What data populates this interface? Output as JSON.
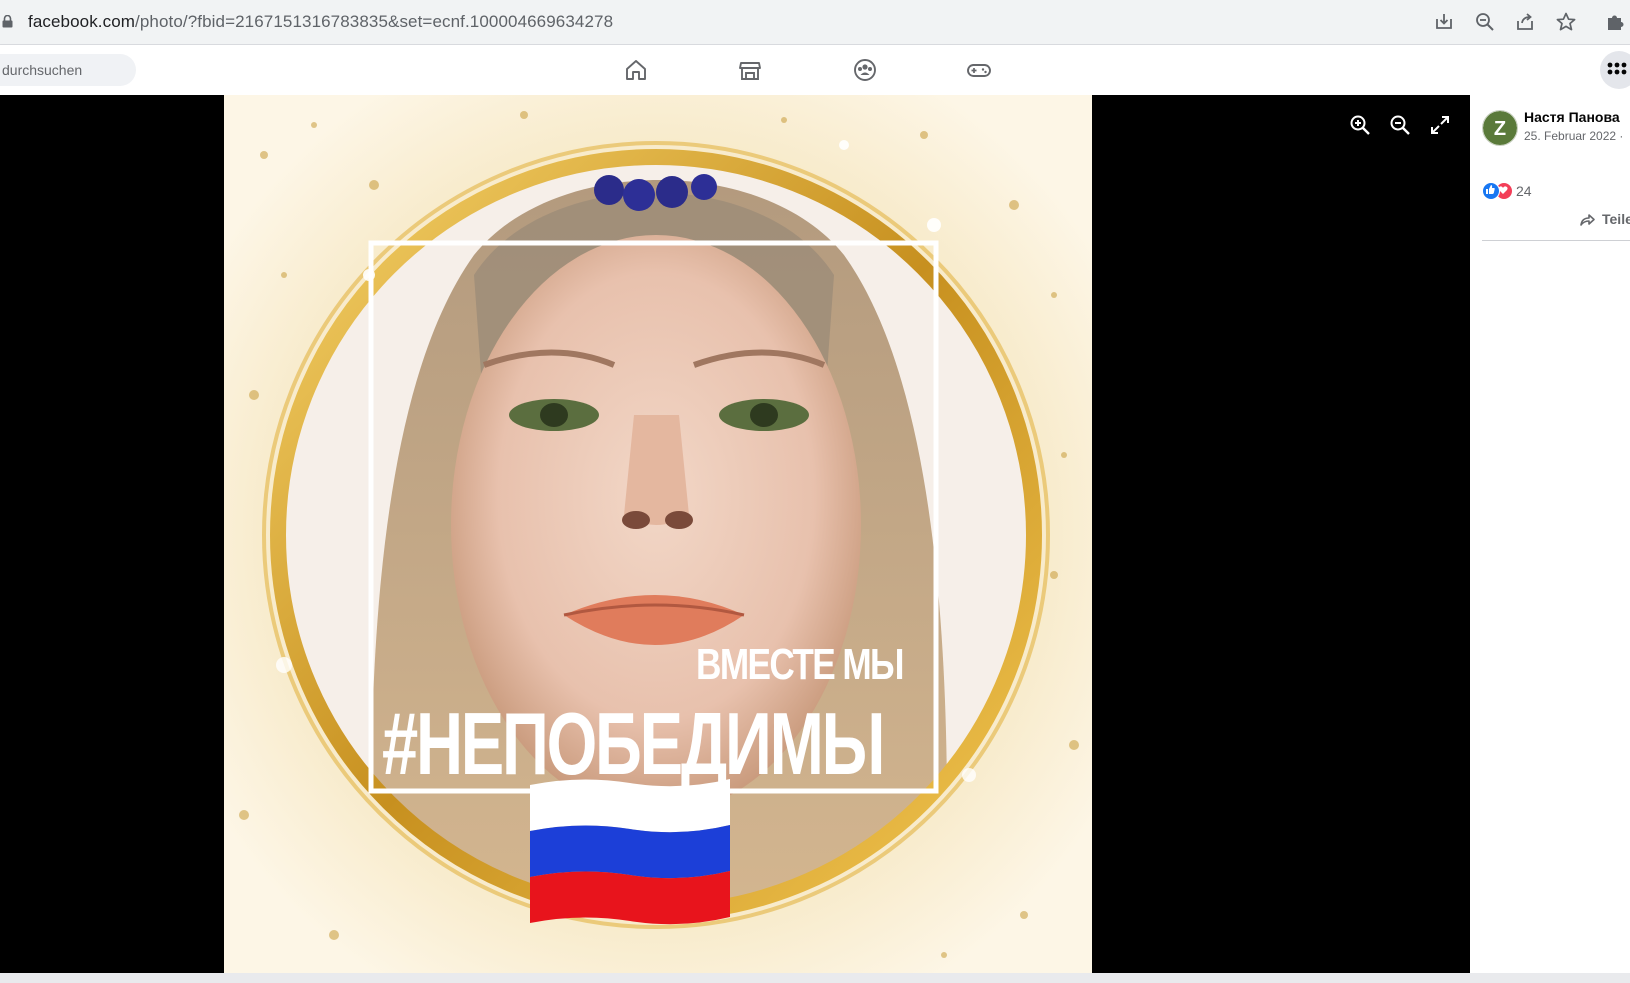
{
  "browser": {
    "url_host": "facebook.com",
    "url_path": "/photo/?fbid=2167151316783835&set=ecnf.100004669634278",
    "icons": [
      "download-icon",
      "zoom-out-icon",
      "share-icon",
      "star-icon",
      "extensions-icon"
    ]
  },
  "fbnav": {
    "search_placeholder": "durchsuchen",
    "icons": [
      "home-icon",
      "marketplace-icon",
      "groups-icon",
      "gaming-icon",
      "menu-grid-icon"
    ]
  },
  "viewer": {
    "controls": [
      "zoom-in-icon",
      "zoom-out-icon",
      "fullscreen-icon"
    ],
    "photo_text": {
      "line1": "ВМЕСТЕ МЫ",
      "line2": "#НЕПОБЕДИМЫ"
    },
    "flag_colors": [
      "#ffffff",
      "#1c3fd8",
      "#e8141c"
    ]
  },
  "post": {
    "author": "Настя Панова",
    "date": "25. Februar 2022 · ",
    "avatar_letter": "Z",
    "reaction_count": "24",
    "share_label": "Teilen"
  },
  "colors": {
    "facebook_blue": "#1877f2",
    "love_red": "#f33e58"
  }
}
